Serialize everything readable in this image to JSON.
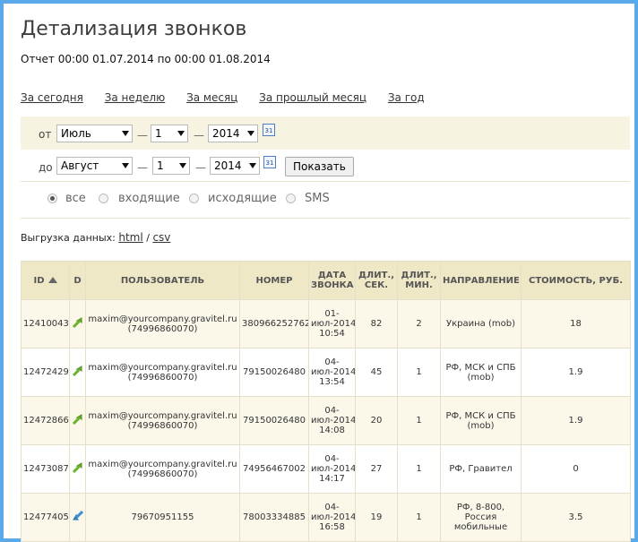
{
  "page": {
    "title": "Детализация звонков",
    "report_range": "Отчет 00:00 01.07.2014 по 00:00 01.08.2014"
  },
  "quick_periods": [
    "За сегодня",
    "За неделю",
    "За месяц",
    "За прошлый месяц",
    "За год"
  ],
  "filter": {
    "from_label": "от",
    "to_label": "до",
    "from": {
      "month": "Июль",
      "day": "1",
      "year": "2014"
    },
    "to": {
      "month": "Август",
      "day": "1",
      "year": "2014"
    },
    "dash": "—",
    "show_button": "Показать",
    "calendar_text": "31"
  },
  "radios": {
    "items": [
      "все",
      "входящие",
      "исходящие",
      "SMS"
    ],
    "selected": "все"
  },
  "export": {
    "label": "Выгрузка данных:",
    "html": "html",
    "sep": "/",
    "csv": "csv"
  },
  "table": {
    "headers": {
      "id": "ID",
      "d": "D",
      "user": "ПОЛЬЗОВАТЕЛЬ",
      "number": "НОМЕР",
      "date": "ДАТА ЗВОНКА",
      "dur_sec": "ДЛИТ., СЕК.",
      "dur_min": "ДЛИТ., МИН.",
      "direction": "НАПРАВЛЕНИЕ",
      "cost": "СТОИМОСТЬ, РУБ."
    },
    "rows": [
      {
        "id": "12410043",
        "dir_icon": "outgoing-call-icon",
        "user": "maxim@yourcompany.gravitel.ru (74996860070)",
        "number": "380966252762",
        "date": "01-июл-2014 10:54",
        "sec": "82",
        "min": "2",
        "direction": "Украина (mob)",
        "cost": "18"
      },
      {
        "id": "12472429",
        "dir_icon": "outgoing-call-icon",
        "user": "maxim@yourcompany.gravitel.ru (74996860070)",
        "number": "79150026480",
        "date": "04-июл-2014 13:54",
        "sec": "45",
        "min": "1",
        "direction": "РФ, МСК и СПБ (mob)",
        "cost": "1.9"
      },
      {
        "id": "12472866",
        "dir_icon": "outgoing-call-icon",
        "user": "maxim@yourcompany.gravitel.ru (74996860070)",
        "number": "79150026480",
        "date": "04-июл-2014 14:08",
        "sec": "20",
        "min": "1",
        "direction": "РФ, МСК и СПБ (mob)",
        "cost": "1.9"
      },
      {
        "id": "12473087",
        "dir_icon": "outgoing-call-icon",
        "user": "maxim@yourcompany.gravitel.ru (74996860070)",
        "number": "74956467002",
        "date": "04-июл-2014 14:17",
        "sec": "27",
        "min": "1",
        "direction": "РФ, Гравител",
        "cost": "0"
      },
      {
        "id": "12477405",
        "dir_icon": "incoming-call-icon",
        "user": "79670951155",
        "number": "78003334885",
        "date": "04-июл-2014 16:58",
        "sec": "19",
        "min": "1",
        "direction": "РФ, 8-800, Россия мобильные",
        "cost": "3.5"
      }
    ]
  },
  "colors": {
    "frame": "#5aa9ea",
    "filter_bg": "#f7f3e1",
    "header_bg": "#efe8c7",
    "outgoing": "#6ab32a",
    "incoming": "#3a8fd8"
  }
}
